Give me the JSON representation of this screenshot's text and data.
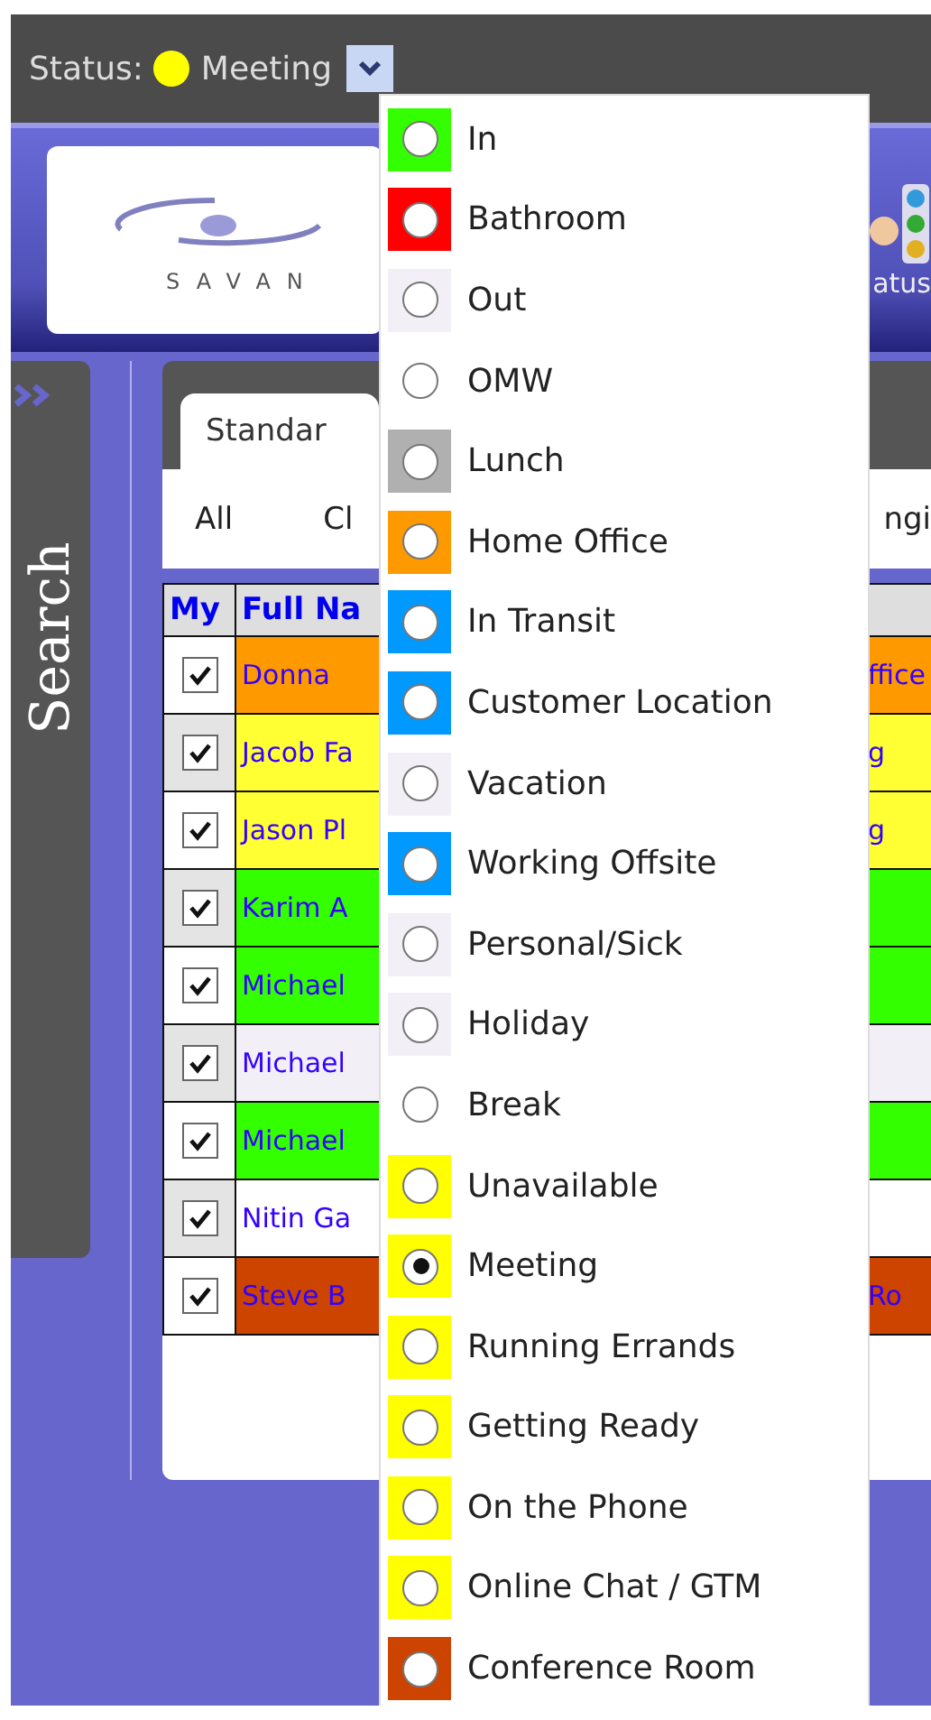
{
  "status_bar": {
    "label": "Status:",
    "color": "#ffff00",
    "value": "Meeting"
  },
  "header": {
    "logo_text": "SAVAN",
    "status_link": "atus"
  },
  "sidebar": {
    "label": "Search"
  },
  "tabs": [
    {
      "label": "Standar",
      "selected": true
    }
  ],
  "filters": [
    "All",
    "Cl",
    "ngi"
  ],
  "table": {
    "columns": [
      "My",
      "Full Na"
    ],
    "rows": [
      {
        "checked": true,
        "color": "#ff9900",
        "name": "Donna",
        "column_3": "ffice"
      },
      {
        "checked": true,
        "color": "#ffff33",
        "name": "Jacob Fa",
        "column_3": "g"
      },
      {
        "checked": true,
        "color": "#ffff33",
        "name": "Jason Pl",
        "column_3": "g"
      },
      {
        "checked": true,
        "color": "#33ff00",
        "name": "Karim A"
      },
      {
        "checked": true,
        "color": "#33ff00",
        "name": "Michael"
      },
      {
        "checked": true,
        "color": "#f2f0f6",
        "name": "Michael"
      },
      {
        "checked": true,
        "color": "#33ff00",
        "name": "Michael"
      },
      {
        "checked": true,
        "color": "#ffffff",
        "name": "Nitin Ga"
      },
      {
        "checked": true,
        "color": "#cc4400",
        "name": "Steve B",
        "column_3": "Ro"
      }
    ]
  },
  "status_menu": [
    {
      "label": "In",
      "color": "#33ff00",
      "selected": false
    },
    {
      "label": "Bathroom",
      "color": "#ff0000",
      "selected": false
    },
    {
      "label": "Out",
      "color": "#f2f0f6",
      "selected": false
    },
    {
      "label": "OMW",
      "selected": false
    },
    {
      "label": "Lunch",
      "color": "#b0b0b0",
      "selected": false
    },
    {
      "label": "Home Office",
      "color": "#ff9900",
      "selected": false
    },
    {
      "label": "In Transit",
      "color": "#0099ff",
      "selected": false
    },
    {
      "label": "Customer Location",
      "color": "#0099ff",
      "selected": false
    },
    {
      "label": "Vacation",
      "color": "#f2f0f6",
      "selected": false
    },
    {
      "label": "Working Offsite",
      "color": "#0099ff",
      "selected": false
    },
    {
      "label": "Personal/Sick",
      "color": "#f2f0f6",
      "selected": false
    },
    {
      "label": "Holiday",
      "color": "#f2f0f6",
      "selected": false
    },
    {
      "label": "Break",
      "selected": false
    },
    {
      "label": "Unavailable",
      "color": "#ffff00",
      "selected": false
    },
    {
      "label": "Meeting",
      "color": "#ffff00",
      "selected": true
    },
    {
      "label": "Running Errands",
      "color": "#ffff00",
      "selected": false
    },
    {
      "label": "Getting Ready",
      "color": "#ffff00",
      "selected": false
    },
    {
      "label": "On the Phone",
      "color": "#ffff00",
      "selected": false
    },
    {
      "label": "Online Chat / GTM",
      "color": "#ffff00",
      "selected": false
    },
    {
      "label": "Conference Room",
      "color": "#cc4400",
      "selected": false
    }
  ]
}
